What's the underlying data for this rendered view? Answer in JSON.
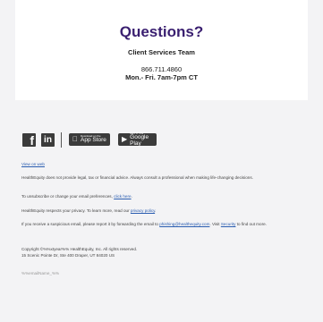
{
  "contact": {
    "title": "Questions?",
    "team": "Client Services Team",
    "phone": "866.711.4860",
    "hours": "Mon.- Fri. 7am-7pm CT"
  },
  "social": {
    "facebook_glyph": "f",
    "linkedin_glyph": "in",
    "app_store_small": "Download on the",
    "app_store_big": "App Store",
    "google_play_small": "GET IT ON",
    "google_play_big": "Google Play"
  },
  "footer": {
    "view_on_web": "View on web",
    "advice": "HealthEquity does not provide legal, tax or financial advice. Always consult a professional when making life-changing decisions.",
    "unsub_text": "To unsubscribe or change your email preferences,",
    "unsub_link": "click here",
    "privacy_text": "HealthEquity respects your privacy. To learn more, read our",
    "privacy_link": "privacy policy",
    "phish_text_1": "If you receive a suspicious email, please report it by forwarding the email to",
    "phish_email": "phishing@healthequity.com",
    "phish_text_2": ". Visit",
    "security_link": "Security",
    "phish_text_3": "to find out more.",
    "copyright": "Copyright ©%%xtyear%% HealthEquity, Inc. All rights reserved.",
    "address": "15 Scenic Pointe Dr, Ste 400 Draper, UT 84020 US",
    "email_name": "%%emailName_%%"
  },
  "colors": {
    "title": "#3a1f70",
    "link": "#2a5db0",
    "page_bg": "#f3f3f5",
    "icon_bg": "#3b3b3b"
  }
}
